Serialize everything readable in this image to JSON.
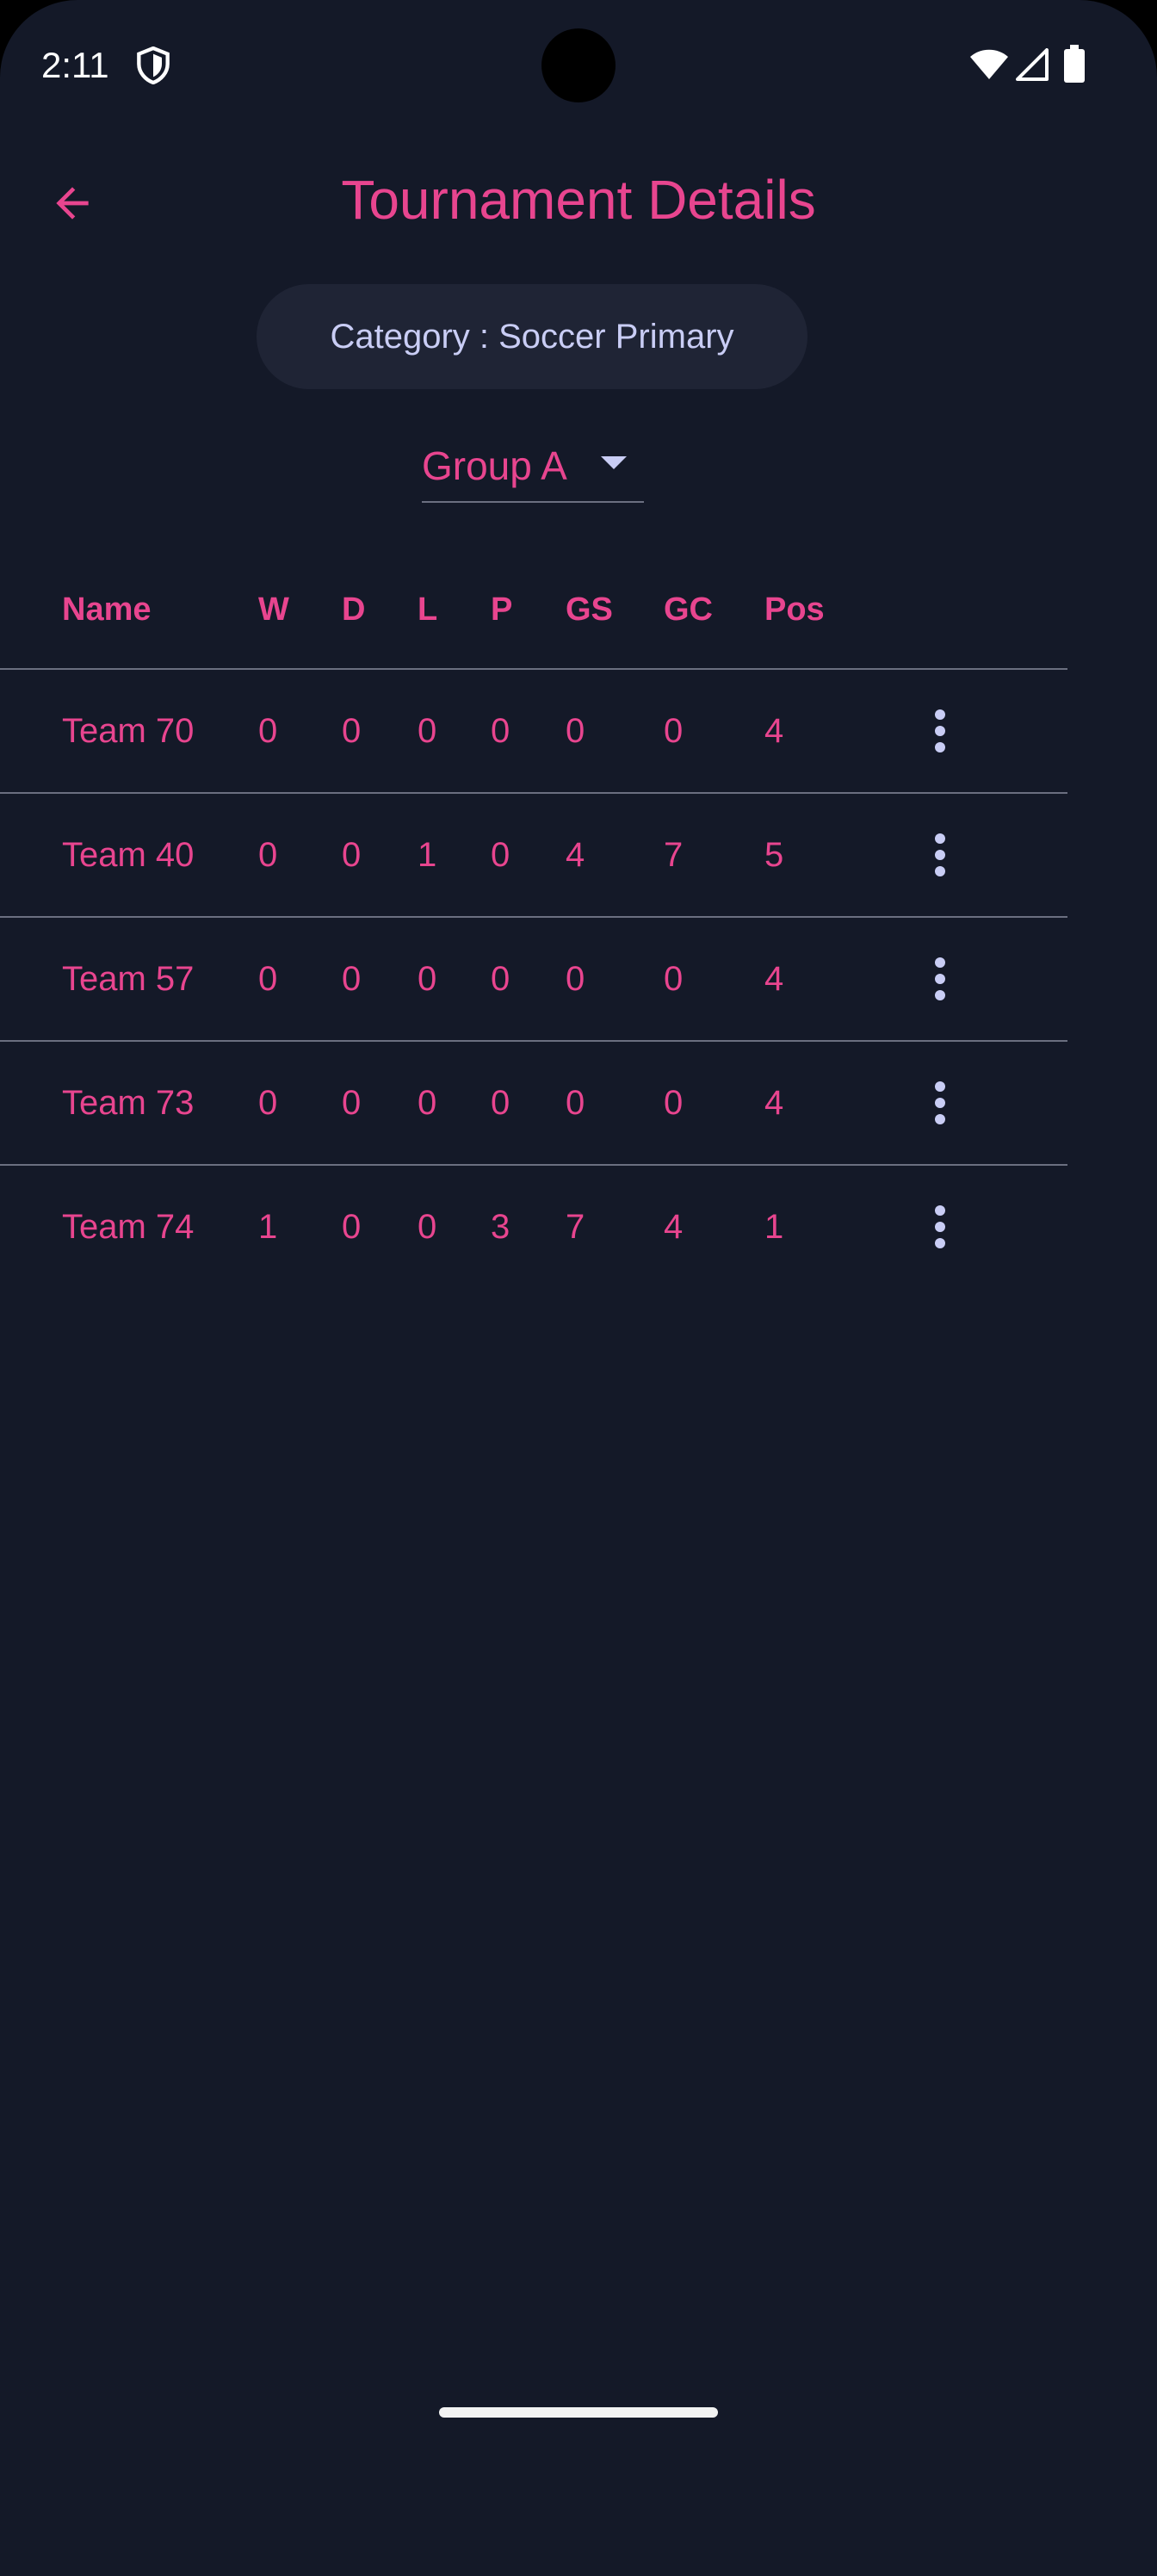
{
  "status_bar": {
    "time": "2:11",
    "icons": [
      "shield-icon",
      "wifi-icon",
      "signal-icon",
      "battery-icon"
    ]
  },
  "app_bar": {
    "title": "Tournament Details",
    "back_icon": "arrow-left-icon"
  },
  "category": {
    "label": "Category : Soccer Primary"
  },
  "group_select": {
    "value": "Group A"
  },
  "table": {
    "columns": [
      "Name",
      "W",
      "D",
      "L",
      "P",
      "GS",
      "GC",
      "Pos"
    ],
    "rows": [
      {
        "name": "Team 70",
        "w": "0",
        "d": "0",
        "l": "0",
        "p": "0",
        "gs": "0",
        "gc": "0",
        "pos": "4"
      },
      {
        "name": "Team 40",
        "w": "0",
        "d": "0",
        "l": "1",
        "p": "0",
        "gs": "4",
        "gc": "7",
        "pos": "5"
      },
      {
        "name": "Team 57",
        "w": "0",
        "d": "0",
        "l": "0",
        "p": "0",
        "gs": "0",
        "gc": "0",
        "pos": "4"
      },
      {
        "name": "Team 73",
        "w": "0",
        "d": "0",
        "l": "0",
        "p": "0",
        "gs": "0",
        "gc": "0",
        "pos": "4"
      },
      {
        "name": "Team 74",
        "w": "1",
        "d": "0",
        "l": "0",
        "p": "3",
        "gs": "7",
        "gc": "4",
        "pos": "1"
      }
    ]
  },
  "colors": {
    "background": "#141928",
    "accent": "#e8458f",
    "chip": "#1f2435",
    "chip_text": "#c9cdf5",
    "divider": "#6b6f80"
  }
}
